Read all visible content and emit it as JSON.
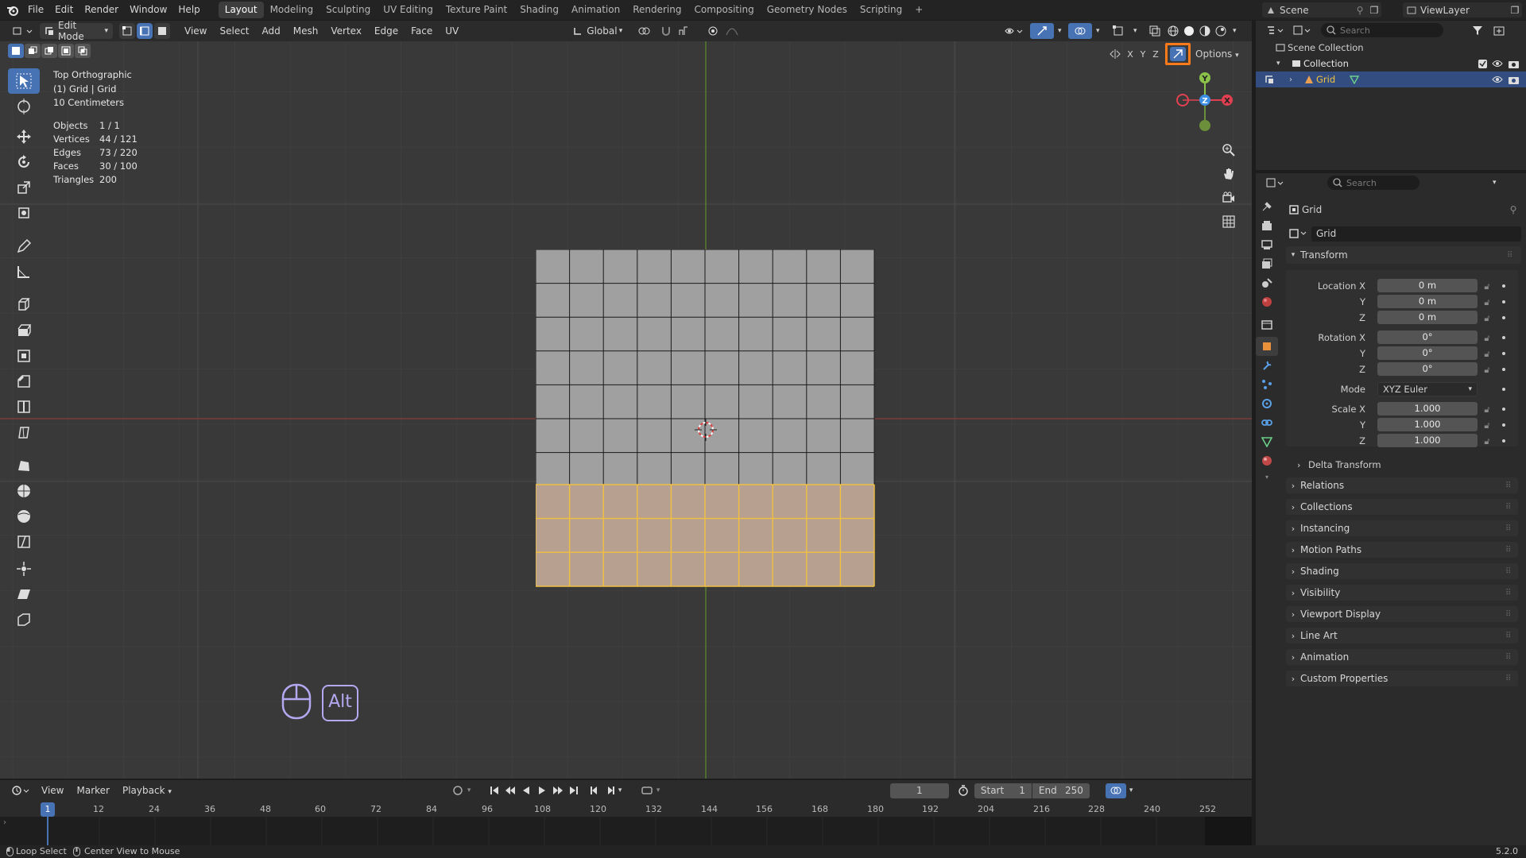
{
  "topbar": {
    "menus": [
      "File",
      "Edit",
      "Render",
      "Window",
      "Help"
    ],
    "workspaces": [
      "Layout",
      "Modeling",
      "Sculpting",
      "UV Editing",
      "Texture Paint",
      "Shading",
      "Animation",
      "Rendering",
      "Compositing",
      "Geometry Nodes",
      "Scripting"
    ],
    "active_workspace": "Layout",
    "add_tab": "+",
    "scene": "Scene",
    "view_layer": "ViewLayer"
  },
  "viewport_header": {
    "mode": "Edit Mode",
    "menus": [
      "View",
      "Select",
      "Add",
      "Mesh",
      "Vertex",
      "Edge",
      "Face",
      "UV"
    ],
    "orientation": "Global",
    "options": "Options",
    "axes": [
      "X",
      "Y",
      "Z"
    ]
  },
  "overlay": {
    "view_name": "Top Orthographic",
    "object_name": "(1) Grid | Grid",
    "scale": "10 Centimeters",
    "stats": [
      {
        "label": "Objects",
        "value": "1 / 1"
      },
      {
        "label": "Vertices",
        "value": "44 / 121"
      },
      {
        "label": "Edges",
        "value": "73 / 220"
      },
      {
        "label": "Faces",
        "value": "30 / 100"
      },
      {
        "label": "Triangles",
        "value": "200"
      }
    ]
  },
  "gizmo": {
    "x": "X",
    "y": "Y",
    "z": "Z"
  },
  "key_hint": "Alt",
  "outliner": {
    "search_placeholder": "Search",
    "scene_collection": "Scene Collection",
    "collection": "Collection",
    "object": "Grid"
  },
  "properties": {
    "search_placeholder": "Search",
    "object_name": "Grid",
    "datablock": "Grid",
    "transform_title": "Transform",
    "location_label": "Location X",
    "rotation_label": "Rotation X",
    "scale_label": "Scale X",
    "y_label": "Y",
    "z_label": "Z",
    "mode_label": "Mode",
    "mode_value": "XYZ Euler",
    "location": [
      "0 m",
      "0 m",
      "0 m"
    ],
    "rotation": [
      "0°",
      "0°",
      "0°"
    ],
    "scale": [
      "1.000",
      "1.000",
      "1.000"
    ],
    "delta": "Delta Transform",
    "panels": [
      "Relations",
      "Collections",
      "Instancing",
      "Motion Paths",
      "Shading",
      "Visibility",
      "Viewport Display",
      "Line Art",
      "Animation",
      "Custom Properties"
    ]
  },
  "timeline": {
    "menus": [
      "View",
      "Marker",
      "Playback"
    ],
    "current_frame": "1",
    "start_label": "Start",
    "start": "1",
    "end_label": "End",
    "end": "250",
    "ruler": [
      "12",
      "24",
      "36",
      "48",
      "60",
      "72",
      "84",
      "96",
      "108",
      "120",
      "132",
      "144",
      "156",
      "168",
      "180",
      "192",
      "204",
      "216",
      "228",
      "240",
      "252"
    ],
    "playhead": "1"
  },
  "statusbar": {
    "left1": "Loop Select",
    "left2": "Center View to Mouse",
    "version": "5.2.0"
  },
  "colors": {
    "accent": "#4772b3",
    "selection": "#f0c040",
    "highlight_box": "#ff7a1a"
  }
}
